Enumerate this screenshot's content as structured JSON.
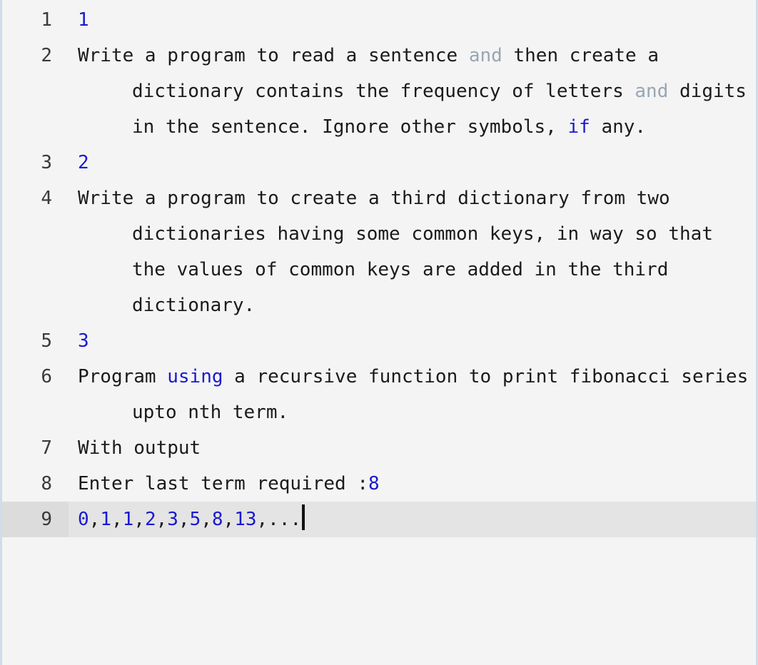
{
  "editor": {
    "background_color": "#f4f4f4",
    "border_color": "#cfdcea",
    "active_line_bg": "#e4e4e4",
    "active_gutter_bg": "#dcdcdc",
    "text_color": "#1b1b1b",
    "number_color": "#1a1ad0",
    "keyword_color": "#1a1ad0",
    "soft_keyword_color": "#98a6b4",
    "caret_color": "#111111",
    "active_line": 9,
    "total_lines": 9
  },
  "lines": [
    {
      "number": "1",
      "text": "1",
      "tokens": [
        {
          "kind": "num",
          "text": "1"
        }
      ]
    },
    {
      "number": "2",
      "text": "Write a program to read a sentence and then create a dictionary contains the frequency of letters and digits in the sentence. Ignore other symbols, if any.",
      "tokens": [
        {
          "kind": "plain",
          "text": "Write a program to read a sentence "
        },
        {
          "kind": "kw-soft",
          "text": "and"
        },
        {
          "kind": "plain",
          "text": " then create a dictionary contains the frequency of letters "
        },
        {
          "kind": "kw-soft",
          "text": "and"
        },
        {
          "kind": "plain",
          "text": " digits in the sentence. Ignore other symbols, "
        },
        {
          "kind": "kw",
          "text": "if"
        },
        {
          "kind": "plain",
          "text": " any."
        }
      ]
    },
    {
      "number": "3",
      "text": "2",
      "tokens": [
        {
          "kind": "num",
          "text": "2"
        }
      ]
    },
    {
      "number": "4",
      "text": "Write a program to create a third dictionary from two dictionaries having some common keys, in way so that the values of common keys are added in the third dictionary.",
      "tokens": [
        {
          "kind": "plain",
          "text": "Write a program to create a third dictionary from two dictionaries having some common keys, in way so that the values of common keys are added in the third dictionary."
        }
      ]
    },
    {
      "number": "5",
      "text": "3",
      "tokens": [
        {
          "kind": "num",
          "text": "3"
        }
      ]
    },
    {
      "number": "6",
      "text": "Program using a recursive function to print fibonacci series upto nth term.",
      "tokens": [
        {
          "kind": "plain",
          "text": "Program "
        },
        {
          "kind": "kw",
          "text": "using"
        },
        {
          "kind": "plain",
          "text": " a recursive function to print fibonacci series upto nth term."
        }
      ]
    },
    {
      "number": "7",
      "text": "With output",
      "tokens": [
        {
          "kind": "plain",
          "text": "With output"
        }
      ]
    },
    {
      "number": "8",
      "text": "Enter last term required :8",
      "tokens": [
        {
          "kind": "plain",
          "text": "Enter last term required :"
        },
        {
          "kind": "num",
          "text": "8"
        }
      ]
    },
    {
      "number": "9",
      "text": "0,1,1,2,3,5,8,13,...",
      "active": true,
      "caret": true,
      "tokens": [
        {
          "kind": "num",
          "text": "0"
        },
        {
          "kind": "plain",
          "text": ","
        },
        {
          "kind": "num",
          "text": "1"
        },
        {
          "kind": "plain",
          "text": ","
        },
        {
          "kind": "num",
          "text": "1"
        },
        {
          "kind": "plain",
          "text": ","
        },
        {
          "kind": "num",
          "text": "2"
        },
        {
          "kind": "plain",
          "text": ","
        },
        {
          "kind": "num",
          "text": "3"
        },
        {
          "kind": "plain",
          "text": ","
        },
        {
          "kind": "num",
          "text": "5"
        },
        {
          "kind": "plain",
          "text": ","
        },
        {
          "kind": "num",
          "text": "8"
        },
        {
          "kind": "plain",
          "text": ","
        },
        {
          "kind": "num",
          "text": "13"
        },
        {
          "kind": "plain",
          "text": ",..."
        }
      ]
    }
  ]
}
